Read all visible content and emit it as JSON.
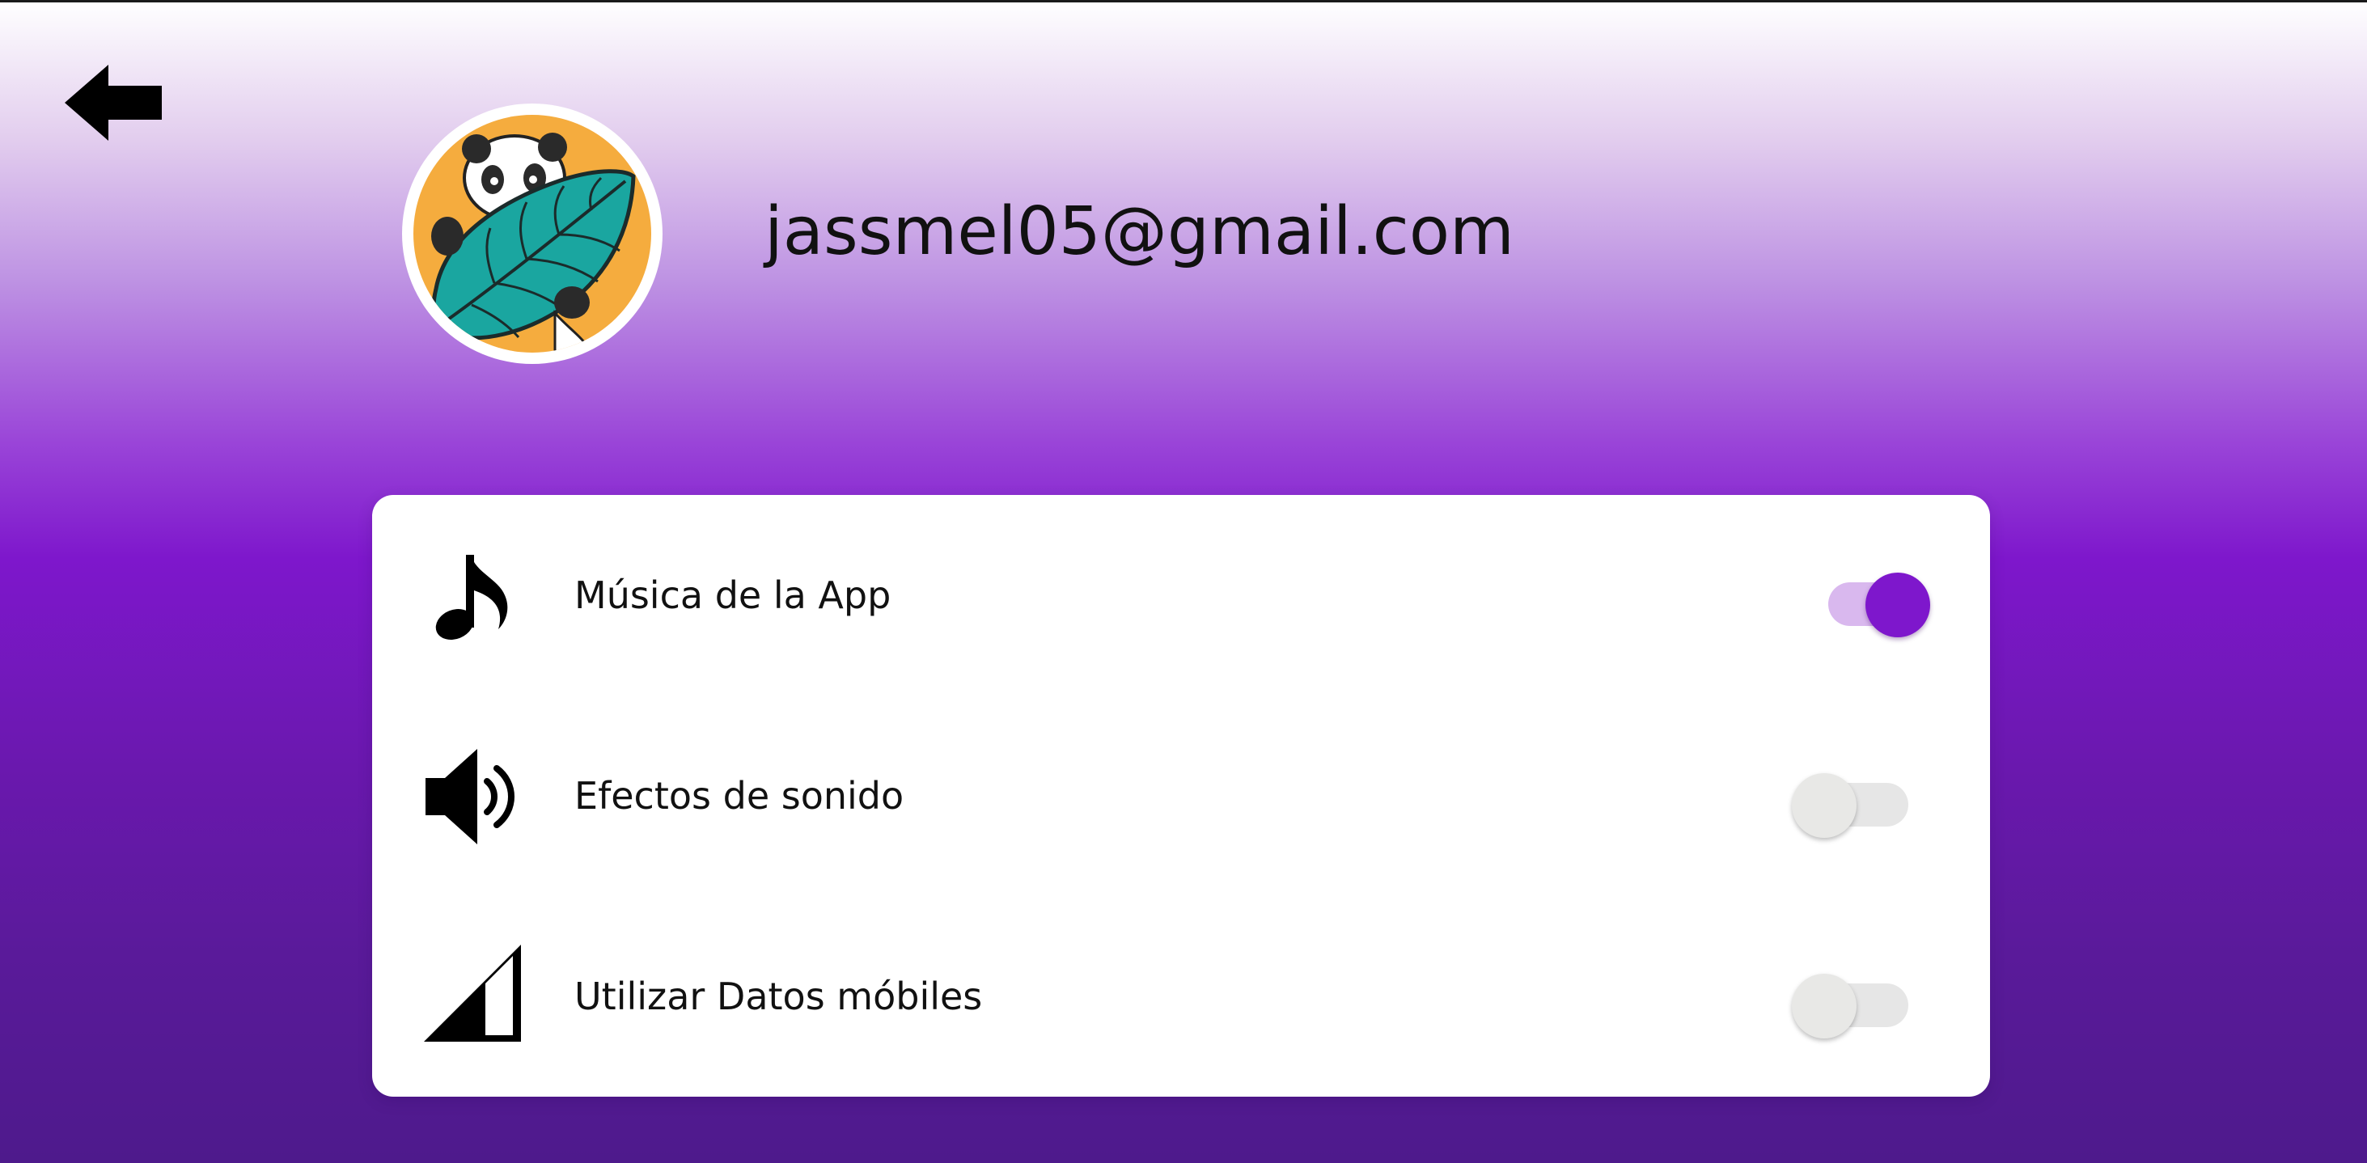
{
  "profile": {
    "email": "jassmel05@gmail.com"
  },
  "settings": [
    {
      "label": "Música de la App",
      "icon": "music-note-icon",
      "enabled": true
    },
    {
      "label": "Efectos de sonido",
      "icon": "speaker-icon",
      "enabled": false
    },
    {
      "label": "Utilizar Datos móbiles",
      "icon": "signal-icon",
      "enabled": false
    }
  ],
  "colors": {
    "accent": "#7e17cc",
    "accent_track": "#d9b8ee",
    "toggle_off": "#e8e8e6",
    "avatar_bg": "#f5ac3e",
    "leaf": "#1aa6a0"
  }
}
